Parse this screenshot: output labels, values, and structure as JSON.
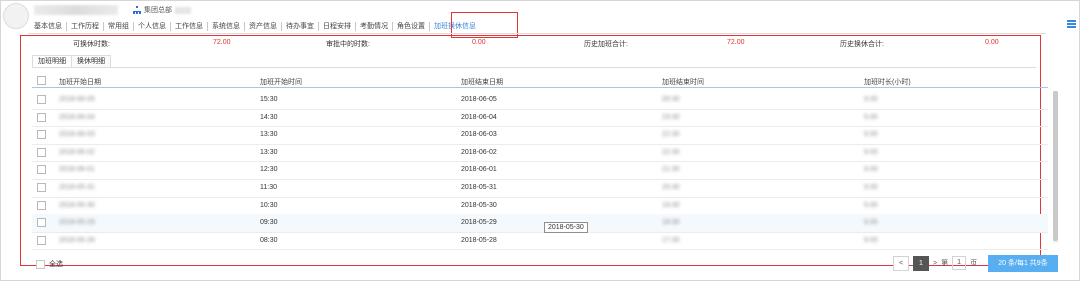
{
  "header": {
    "department": "集团总部",
    "tabs": [
      "基本信息",
      "工作历程",
      "常用组",
      "个人信息",
      "工作信息",
      "系统信息",
      "资产信息",
      "待办事宜",
      "日程安排",
      "考勤情况",
      "角色设置",
      "加班换休信息"
    ],
    "active_tab_index": 11,
    "accent_color": "#3a86d8",
    "highlight_color": "#e2353a"
  },
  "summary": {
    "available_label": "可换休时数:",
    "available_value": "72.00",
    "reviewing_label": "审批中的时数:",
    "reviewing_value": "0.00",
    "history_overtime_label": "历史加班合计:",
    "history_overtime_value": "72.00",
    "history_leave_label": "历史换休合计:",
    "history_leave_value": "0.00"
  },
  "subtabs": [
    "加班明细",
    "换休明细"
  ],
  "table": {
    "columns": [
      "加班开始日期",
      "加班开始时间",
      "加班结束日期",
      "加班结束时间",
      "加班时长(小时)"
    ],
    "rows": [
      {
        "start_date": "2018-06-05",
        "start_time": "15:30",
        "end_date": "2018-06-05",
        "end_time": "00:30",
        "hours": "9.00"
      },
      {
        "start_date": "2018-06-04",
        "start_time": "14:30",
        "end_date": "2018-06-04",
        "end_time": "23:30",
        "hours": "9.00"
      },
      {
        "start_date": "2018-06-03",
        "start_time": "13:30",
        "end_date": "2018-06-03",
        "end_time": "22:30",
        "hours": "9.00"
      },
      {
        "start_date": "2018-06-02",
        "start_time": "13:30",
        "end_date": "2018-06-02",
        "end_time": "22:30",
        "hours": "9.00"
      },
      {
        "start_date": "2018-06-01",
        "start_time": "12:30",
        "end_date": "2018-06-01",
        "end_time": "21:30",
        "hours": "9.00"
      },
      {
        "start_date": "2018-05-31",
        "start_time": "11:30",
        "end_date": "2018-05-31",
        "end_time": "20:30",
        "hours": "9.00"
      },
      {
        "start_date": "2018-05-30",
        "start_time": "10:30",
        "end_date": "2018-05-30",
        "end_time": "19:30",
        "hours": "9.00"
      },
      {
        "start_date": "2018-05-29",
        "start_time": "09:30",
        "end_date": "2018-05-29",
        "end_time": "18:30",
        "hours": "9.00"
      },
      {
        "start_date": "2018-05-28",
        "start_time": "08:30",
        "end_date": "2018-05-28",
        "end_time": "17:30",
        "hours": "9.00"
      }
    ],
    "highlighted_row_index": 7
  },
  "tooltip": "2018-05-30",
  "footer": {
    "select_all": "全选",
    "pager": {
      "prev": "<",
      "current": "1",
      "next": ">",
      "goto_prefix": "第",
      "page_value": "1",
      "goto_suffix": "页"
    },
    "action_label": "20 条/每1 共9条"
  }
}
